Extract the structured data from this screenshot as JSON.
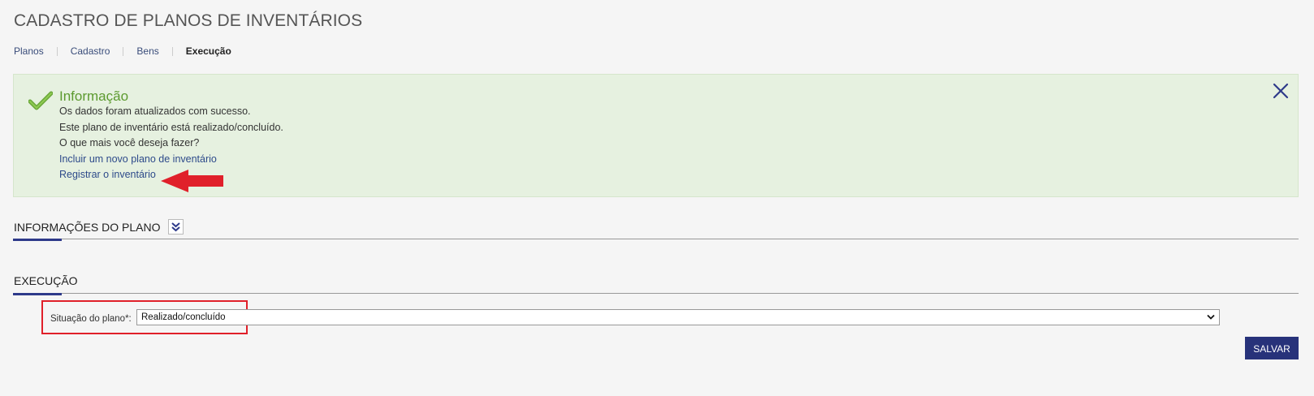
{
  "page": {
    "title": "CADASTRO DE PLANOS DE INVENTÁRIOS"
  },
  "breadcrumb": {
    "items": [
      {
        "label": "Planos"
      },
      {
        "label": "Cadastro"
      },
      {
        "label": "Bens"
      },
      {
        "label": "Execução"
      }
    ]
  },
  "info": {
    "title": "Informação",
    "lines": [
      "Os dados foram atualizados com sucesso.",
      "Este plano de inventário está realizado/concluído.",
      "O que mais você deseja fazer?"
    ],
    "links": [
      "Incluir um novo plano de inventário",
      "Registrar o inventário"
    ],
    "icon": "check-icon",
    "close_icon": "close-icon"
  },
  "sections": {
    "plan_info": {
      "title": "INFORMAÇÕES DO PLANO",
      "toggle_icon": "double-chevron-down-icon"
    },
    "execution": {
      "title": "EXECUÇÃO"
    }
  },
  "form": {
    "situation_label": "Situação do plano*:",
    "situation_value": "Realizado/concluído"
  },
  "actions": {
    "save_label": "SALVAR"
  },
  "colors": {
    "accent": "#2e3a8a",
    "save_button": "#27327a",
    "info_bg": "#e6f1e0",
    "info_title": "#5c9a2f",
    "annotation_red": "#e0202a"
  }
}
